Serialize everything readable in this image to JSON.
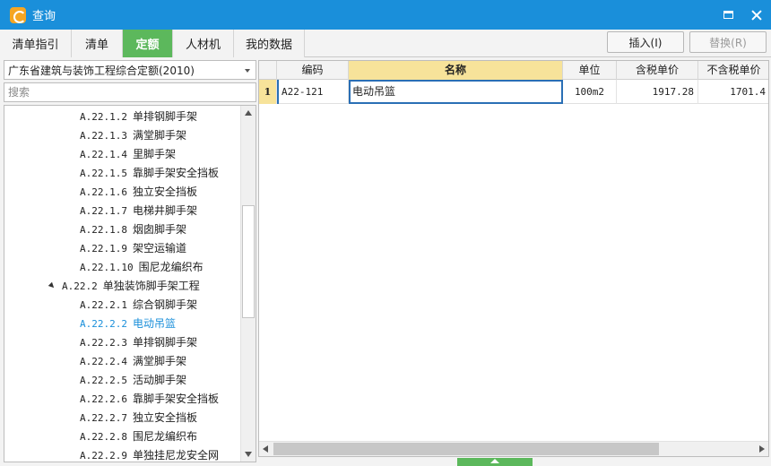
{
  "window": {
    "title": "查询"
  },
  "tabs": [
    "清单指引",
    "清单",
    "定额",
    "人材机",
    "我的数据"
  ],
  "active_tab": "定额",
  "toolbar": {
    "insert_label": "插入(I)",
    "replace_label": "替换(R)"
  },
  "quota_library": {
    "selected": "广东省建筑与装饰工程综合定额(2010)"
  },
  "search": {
    "placeholder": "搜索",
    "value": ""
  },
  "tree": {
    "items": [
      {
        "code": "A.22.1.2",
        "name": "单排钢脚手架",
        "level": 3
      },
      {
        "code": "A.22.1.3",
        "name": "满堂脚手架",
        "level": 3
      },
      {
        "code": "A.22.1.4",
        "name": "里脚手架",
        "level": 3
      },
      {
        "code": "A.22.1.5",
        "name": "靠脚手架安全挡板",
        "level": 3
      },
      {
        "code": "A.22.1.6",
        "name": "独立安全挡板",
        "level": 3
      },
      {
        "code": "A.22.1.7",
        "name": "电梯井脚手架",
        "level": 3
      },
      {
        "code": "A.22.1.8",
        "name": "烟囱脚手架",
        "level": 3
      },
      {
        "code": "A.22.1.9",
        "name": "架空运输道",
        "level": 3
      },
      {
        "code": "A.22.1.10",
        "name": "围尼龙编织布",
        "level": 3
      },
      {
        "code": "A.22.2",
        "name": "单独装饰脚手架工程",
        "level": 2,
        "expanded": true
      },
      {
        "code": "A.22.2.1",
        "name": "综合钢脚手架",
        "level": 3
      },
      {
        "code": "A.22.2.2",
        "name": "电动吊篮",
        "level": 3,
        "selected": true
      },
      {
        "code": "A.22.2.3",
        "name": "单排钢脚手架",
        "level": 3
      },
      {
        "code": "A.22.2.4",
        "name": "满堂脚手架",
        "level": 3
      },
      {
        "code": "A.22.2.5",
        "name": "活动脚手架",
        "level": 3
      },
      {
        "code": "A.22.2.6",
        "name": "靠脚手架安全挡板",
        "level": 3
      },
      {
        "code": "A.22.2.7",
        "name": "独立安全挡板",
        "level": 3
      },
      {
        "code": "A.22.2.8",
        "name": "围尼龙编织布",
        "level": 3
      },
      {
        "code": "A.22.2.9",
        "name": "单独挂尼龙安全网",
        "level": 3
      }
    ]
  },
  "grid": {
    "columns": [
      "编码",
      "名称",
      "单位",
      "含税单价",
      "不含税单价"
    ],
    "rows": [
      {
        "index": "1",
        "code": "A22-121",
        "name": "电动吊篮",
        "unit": "100m2",
        "price_tax": "1917.28",
        "price_notax": "1701.4"
      }
    ]
  },
  "colors": {
    "titlebar": "#1a8fda",
    "active_tab": "#5cb85c",
    "selected_tree": "#1a8fda",
    "header_highlight": "#f7e39a"
  }
}
